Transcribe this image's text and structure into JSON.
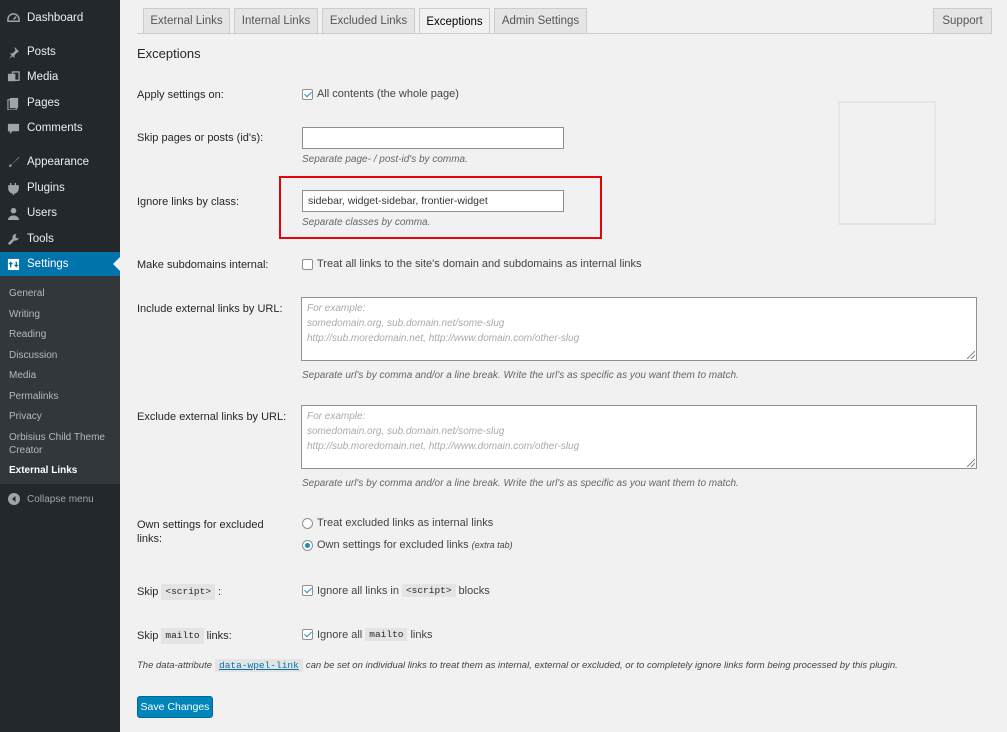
{
  "sidebar": {
    "items": [
      {
        "label": "Dashboard",
        "icon": "dashboard-icon"
      },
      {
        "label": "Posts",
        "icon": "pin-icon"
      },
      {
        "label": "Media",
        "icon": "media-icon"
      },
      {
        "label": "Pages",
        "icon": "pages-icon"
      },
      {
        "label": "Comments",
        "icon": "comment-icon"
      },
      {
        "label": "Appearance",
        "icon": "brush-icon"
      },
      {
        "label": "Plugins",
        "icon": "plugin-icon"
      },
      {
        "label": "Users",
        "icon": "user-icon"
      },
      {
        "label": "Tools",
        "icon": "wrench-icon"
      },
      {
        "label": "Settings",
        "icon": "settings-icon"
      }
    ],
    "submenu": [
      "General",
      "Writing",
      "Reading",
      "Discussion",
      "Media",
      "Permalinks",
      "Privacy",
      "Orbisius Child Theme Creator",
      "External Links"
    ],
    "collapse_label": "Collapse menu"
  },
  "tabs": [
    "External Links",
    "Internal Links",
    "Excluded Links",
    "Exceptions",
    "Admin Settings"
  ],
  "support_tab": "Support",
  "page_title": "Exceptions",
  "apply": {
    "label": "Apply settings on:",
    "option": "All contents (the whole page)"
  },
  "skip_pages": {
    "label": "Skip pages or posts (id's):",
    "value": "",
    "desc": "Separate page- / post-id's by comma."
  },
  "ignore_class": {
    "label": "Ignore links by class:",
    "value": "sidebar, widget-sidebar, frontier-widget",
    "desc": "Separate classes by comma."
  },
  "subdomains": {
    "label": "Make subdomains internal:",
    "option": "Treat all links to the site's domain and subdomains as internal links"
  },
  "include_url": {
    "label": "Include external links by URL:",
    "placeholder": [
      "For example:",
      "somedomain.org, sub.domain.net/some-slug",
      "http://sub.moredomain.net, http://www.domain.com/other-slug"
    ],
    "desc": "Separate url's by comma and/or a line break. Write the url's as specific as you want them to match."
  },
  "exclude_url": {
    "label": "Exclude external links by URL:",
    "placeholder": [
      "For example:",
      "somedomain.org, sub.domain.net/some-slug",
      "http://sub.moredomain.net, http://www.domain.com/other-slug"
    ],
    "desc": "Separate url's by comma and/or a line break. Write the url's as specific as you want them to match."
  },
  "own_settings": {
    "label_line1": "Own settings for excluded",
    "label_line2": "links:",
    "opt1": "Treat excluded links as internal links",
    "opt2": "Own settings for excluded links",
    "opt2_extra": "(extra tab)"
  },
  "skip_script": {
    "label_pre": "Skip",
    "code": "<script>",
    "label_post": ":",
    "opt_pre": "Ignore all links in",
    "opt_post": "blocks"
  },
  "skip_mailto": {
    "label_pre": "Skip",
    "code": "mailto",
    "label_post": "links:",
    "opt_pre": "Ignore all",
    "opt_post": "links"
  },
  "note": {
    "pre": "The data-attribute",
    "code": "data-wpel-link",
    "post": "can be set on individual links to treat them as internal, external or excluded, or to completely ignore links form being processed by this plugin."
  },
  "save_label": "Save Changes",
  "colors": {
    "sidebar": "#23282d",
    "active": "#0073aa",
    "highlight": "#e0060b",
    "button": "#0085ba"
  }
}
